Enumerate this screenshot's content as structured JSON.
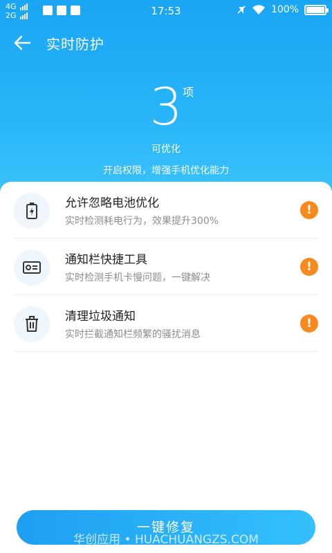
{
  "status_bar": {
    "network1": "4G",
    "network2": "2G",
    "time": "17:53",
    "battery": "100%",
    "left_icons": [
      "security-icon",
      "mail-icon",
      "checkbox-icon"
    ],
    "right_icons": [
      "mute-icon",
      "wifi-icon",
      "battery-icon"
    ]
  },
  "header": {
    "title": "实时防护",
    "back_icon": "arrow-left-icon"
  },
  "summary": {
    "count": "3",
    "unit": "项",
    "label": "可优化",
    "description": "开启权限，增强手机优化能力"
  },
  "items": [
    {
      "icon": "battery-charging-icon",
      "title": "允许忽略电池优化",
      "description": "实时检测耗电行为，效果提升300%",
      "status_icon": "warning-icon"
    },
    {
      "icon": "id-card-icon",
      "title": "通知栏快捷工具",
      "description": "实时检测手机卡慢问题，一键解决",
      "status_icon": "warning-icon"
    },
    {
      "icon": "trash-icon",
      "title": "清理垃圾通知",
      "description": "实时拦截通知栏频繁的骚扰消息",
      "status_icon": "warning-icon"
    }
  ],
  "action": {
    "fix_label": "一键修复"
  },
  "watermark": "华创应用 • HUACHUANGZS.COM",
  "colors": {
    "primary": "#1aa5f3",
    "warning": "#f78a1f",
    "icon_bg": "#eef5fb"
  }
}
